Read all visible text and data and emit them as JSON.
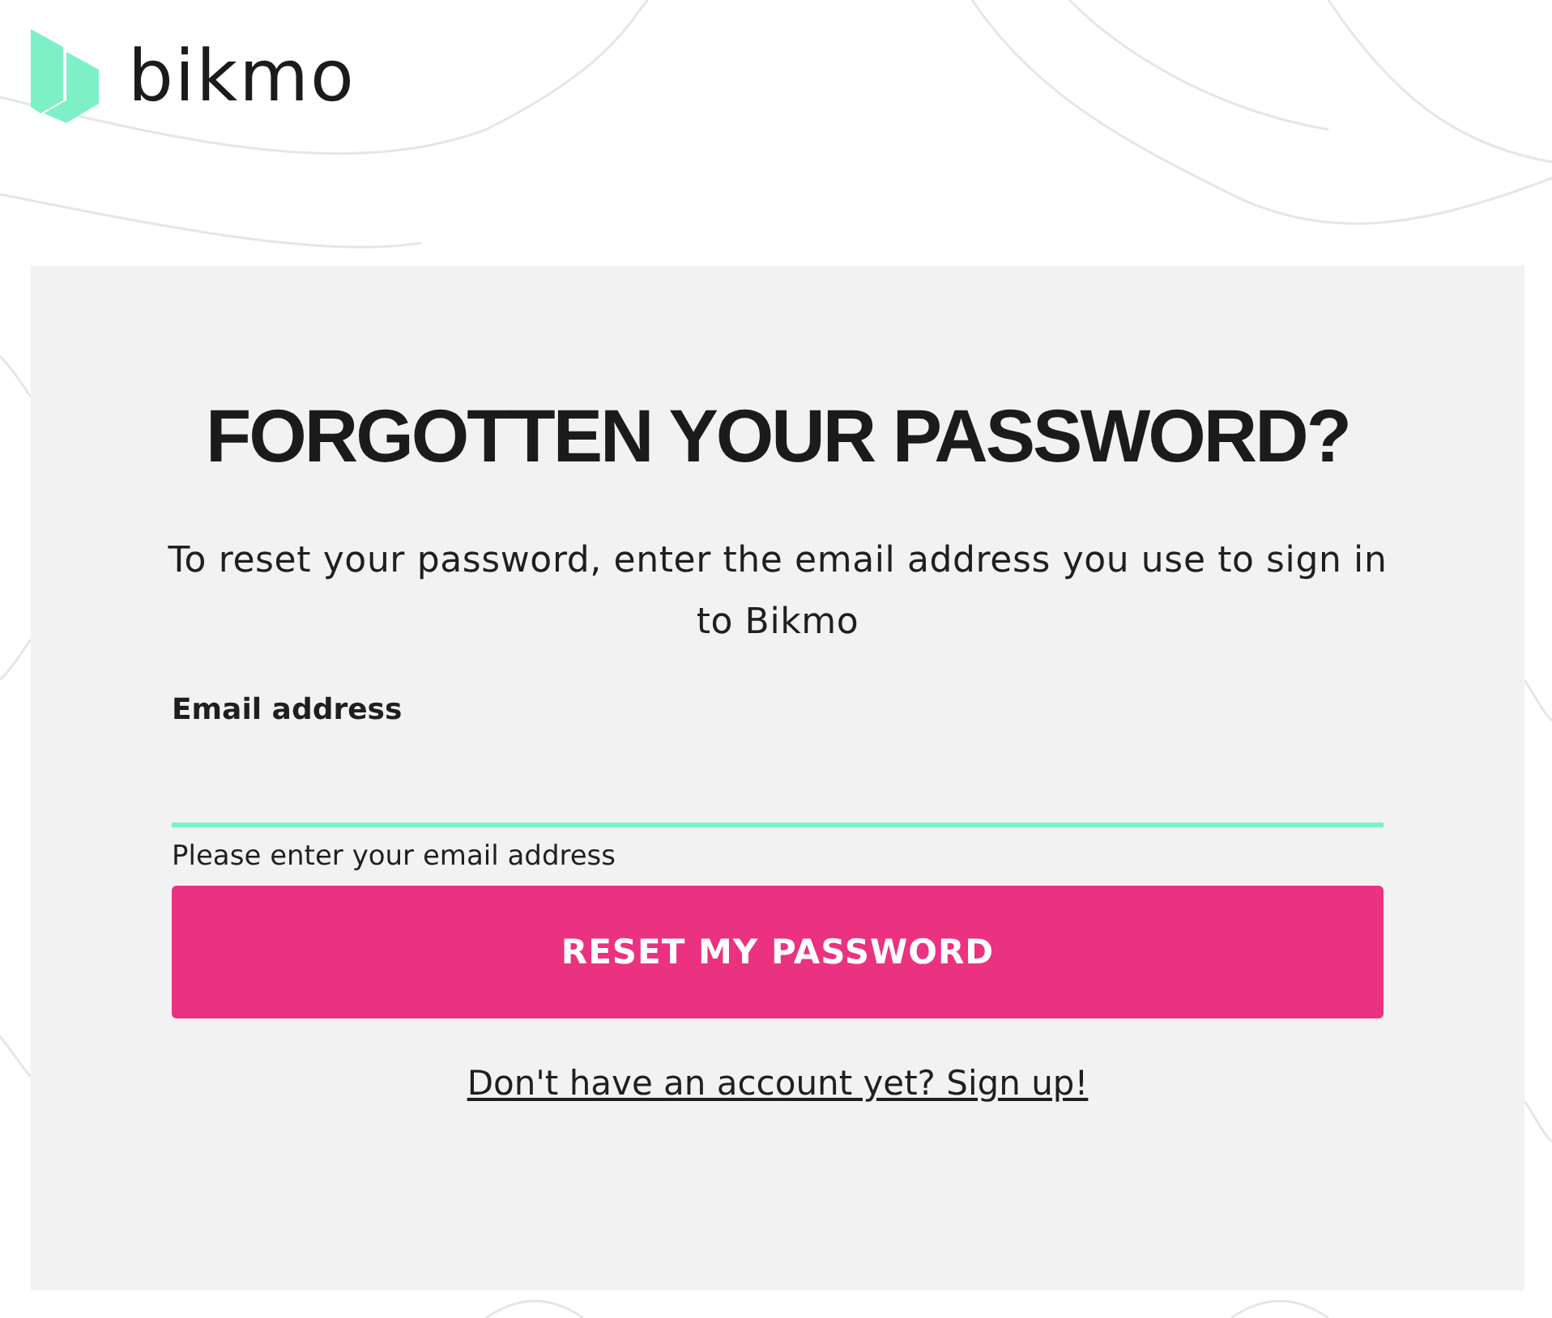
{
  "brand": {
    "name": "bikmo"
  },
  "title": "FORGOTTEN YOUR PASSWORD?",
  "intro": "To reset your password, enter the email address you use to sign in to Bikmo",
  "email_field": {
    "label": "Email address",
    "helper": "Please enter your email address"
  },
  "submit_button": "RESET MY PASSWORD",
  "signup_link": "Don't have an account yet? Sign up!"
}
